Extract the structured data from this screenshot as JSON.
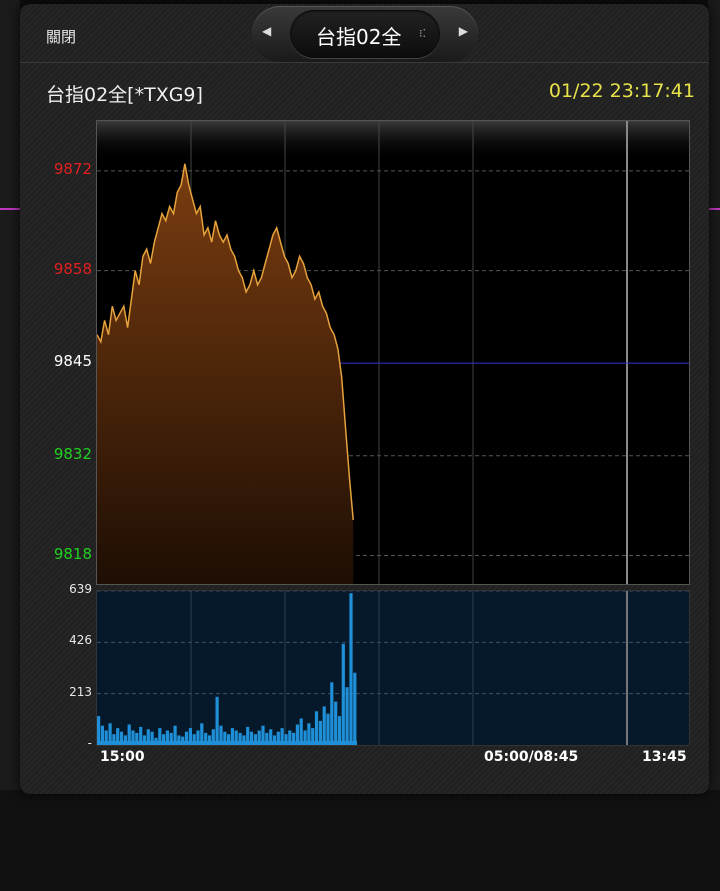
{
  "dialog": {
    "close_label": "關閉",
    "nav_title": "台指02全",
    "nav_prev_icon": "chevron-left-icon",
    "nav_next_icon": "chevron-right-icon",
    "symbol": "台指02全[*TXG9]",
    "timestamp": "01/22 23:17:41"
  },
  "colors": {
    "up": "#e02020",
    "down": "#20d020",
    "flat": "#ffffff",
    "timestamp": "#e8e24a",
    "price_line": "#e6a23c",
    "volume": "#1f8fd8",
    "reference_line": "#3333cc"
  },
  "chart_data": [
    {
      "type": "area",
      "y_ticks": [
        {
          "label": "9872",
          "value": 9872,
          "tone": "up"
        },
        {
          "label": "9858",
          "value": 9858,
          "tone": "up"
        },
        {
          "label": "9845",
          "value": 9845,
          "tone": "flat"
        },
        {
          "label": "9832",
          "value": 9832,
          "tone": "down"
        },
        {
          "label": "9818",
          "value": 9818,
          "tone": "down"
        }
      ],
      "ylim": [
        9814,
        9879
      ],
      "reference": 9845,
      "x_labels": [
        "15:00",
        "05:00/08:45",
        "13:45"
      ],
      "total_slots": 1000,
      "values": [
        9849,
        9848,
        9851,
        9849,
        9853,
        9851,
        9852,
        9853,
        9850,
        9854,
        9858,
        9856,
        9860,
        9861,
        9859,
        9862,
        9864,
        9866,
        9865,
        9867,
        9866,
        9869,
        9870,
        9873,
        9870,
        9868,
        9866,
        9867,
        9863,
        9864,
        9862,
        9865,
        9863,
        9862,
        9863,
        9861,
        9860,
        9858,
        9857,
        9855,
        9856,
        9858,
        9856,
        9857,
        9859,
        9861,
        9863,
        9864,
        9862,
        9860,
        9859,
        9857,
        9858,
        9860,
        9859,
        9857,
        9856,
        9854,
        9855,
        9853,
        9852,
        9850,
        9849,
        9847,
        9843,
        9836,
        9829,
        9823
      ]
    },
    {
      "type": "bar",
      "y_ticks": [
        {
          "label": "639",
          "value": 639
        },
        {
          "label": "426",
          "value": 426
        },
        {
          "label": "213",
          "value": 213
        },
        {
          "label": "-",
          "value": 0
        }
      ],
      "ylim": [
        0,
        639
      ],
      "total_slots": 1000,
      "values": [
        120,
        80,
        60,
        90,
        45,
        70,
        55,
        40,
        85,
        60,
        50,
        75,
        40,
        65,
        55,
        30,
        70,
        45,
        60,
        50,
        80,
        40,
        35,
        55,
        70,
        45,
        60,
        90,
        50,
        40,
        65,
        200,
        80,
        55,
        45,
        70,
        60,
        50,
        40,
        75,
        55,
        45,
        60,
        80,
        50,
        65,
        40,
        55,
        70,
        45,
        60,
        50,
        85,
        110,
        60,
        90,
        70,
        140,
        100,
        160,
        130,
        260,
        180,
        120,
        420,
        240,
        630,
        300
      ]
    }
  ]
}
